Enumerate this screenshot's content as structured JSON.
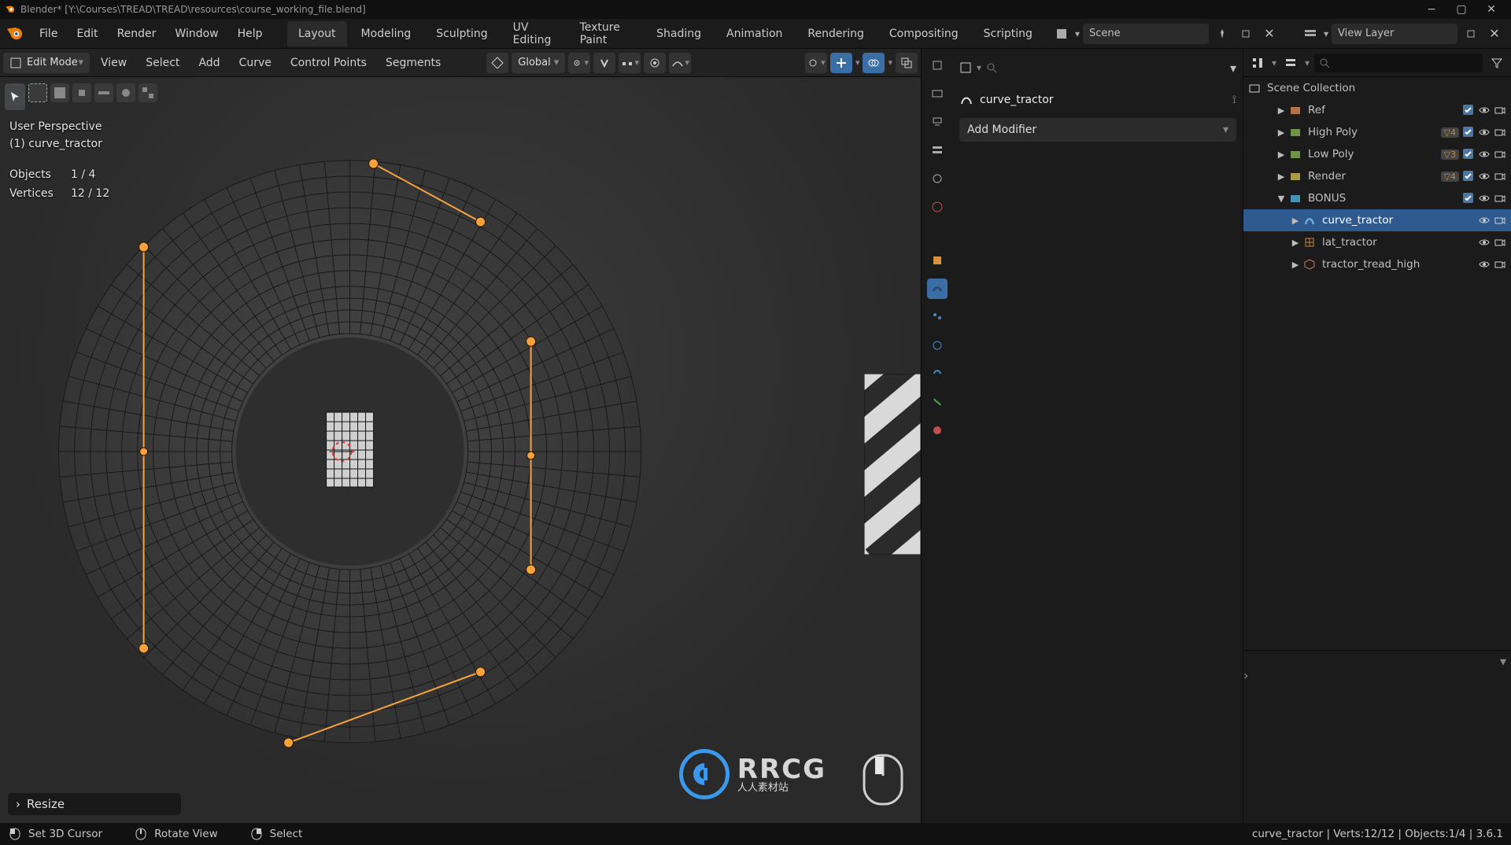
{
  "window": {
    "title": "Blender* [Y:\\Courses\\TREAD\\TREAD\\resources\\course_working_file.blend]"
  },
  "menubar": {
    "items": [
      "File",
      "Edit",
      "Render",
      "Window",
      "Help"
    ],
    "tabs": [
      "Layout",
      "Modeling",
      "Sculpting",
      "UV Editing",
      "Texture Paint",
      "Shading",
      "Animation",
      "Rendering",
      "Compositing",
      "Scripting"
    ],
    "active_tab": 0,
    "scene_label": "Scene",
    "viewlayer_label": "View Layer"
  },
  "secbar": {
    "mode": "Edit Mode",
    "menus": [
      "View",
      "Select",
      "Add",
      "Curve",
      "Control Points",
      "Segments"
    ],
    "orientation": "Global"
  },
  "viewport": {
    "persp": "User Perspective",
    "obj_label": "(1) curve_tractor",
    "stats": {
      "objects": {
        "label": "Objects",
        "value": "1 / 4"
      },
      "vertices": {
        "label": "Vertices",
        "value": "12 / 12"
      }
    },
    "resize_label": "Resize"
  },
  "properties": {
    "object_name": "curve_tractor",
    "add_modifier": "Add Modifier"
  },
  "outliner": {
    "root": "Scene Collection",
    "items": [
      {
        "name": "Ref",
        "depth": 1,
        "kind": "collection",
        "color": "#c77d50",
        "badge": "",
        "sel": false,
        "ex": false
      },
      {
        "name": "High Poly",
        "depth": 1,
        "kind": "collection",
        "color": "#7aa24d",
        "badge": "4",
        "sel": false,
        "ex": false
      },
      {
        "name": "Low Poly",
        "depth": 1,
        "kind": "collection",
        "color": "#7aa24d",
        "badge": "3",
        "sel": false,
        "ex": false
      },
      {
        "name": "Render",
        "depth": 1,
        "kind": "collection",
        "color": "#b6a84f",
        "badge": "4",
        "sel": false,
        "ex": false
      },
      {
        "name": "BONUS",
        "depth": 1,
        "kind": "collection",
        "color": "#4aa0c7",
        "badge": "",
        "sel": false,
        "ex": true
      },
      {
        "name": "curve_tractor",
        "depth": 2,
        "kind": "curve",
        "color": "#6fa7d7",
        "badge": "",
        "sel": true,
        "ex": false
      },
      {
        "name": "lat_tractor",
        "depth": 2,
        "kind": "lattice",
        "color": "#c7813f",
        "badge": "",
        "sel": false,
        "ex": false
      },
      {
        "name": "tractor_tread_high",
        "depth": 2,
        "kind": "mesh",
        "color": "#c77d50",
        "badge": "",
        "sel": false,
        "ex": false
      }
    ]
  },
  "statusbar": {
    "set_cursor": "Set 3D Cursor",
    "rotate_view": "Rotate View",
    "select": "Select",
    "right": "curve_tractor | Verts:12/12 | Objects:1/4 | 3.6.1"
  },
  "watermark": {
    "big": "RRCG",
    "small": "人人素材站"
  }
}
